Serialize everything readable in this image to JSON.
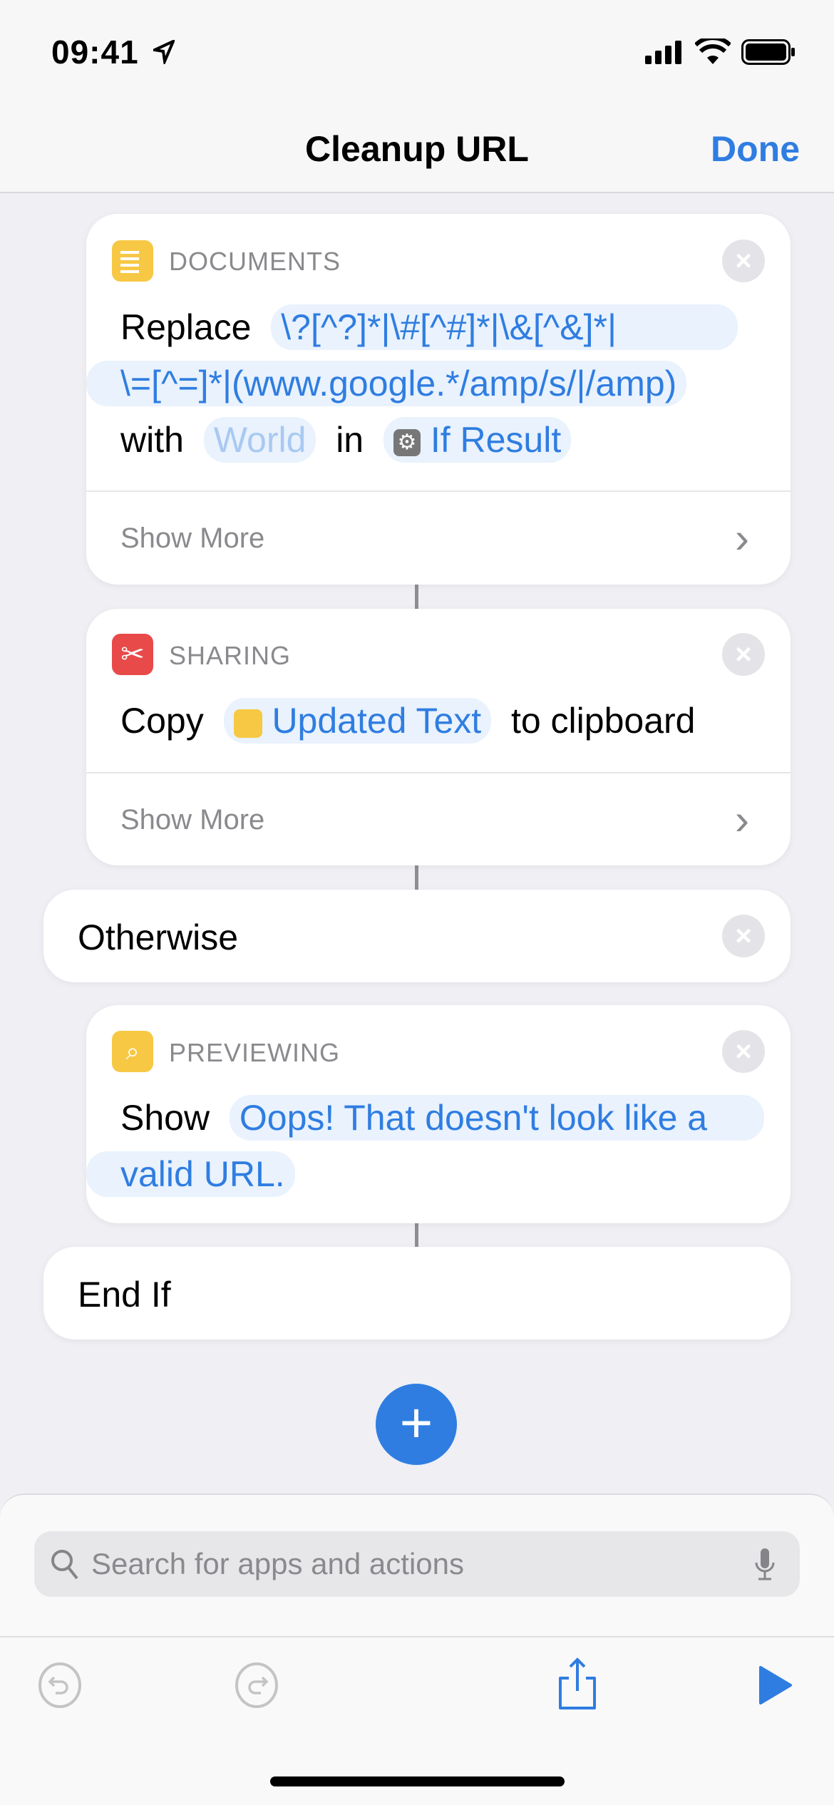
{
  "status": {
    "time": "09:41"
  },
  "nav": {
    "title": "Cleanup URL",
    "done": "Done"
  },
  "cards": [
    {
      "category": "DOCUMENTS",
      "icon": "document-icon",
      "color": "#f7c844",
      "verb": "Replace",
      "pattern_1": "\\?[^?]*|\\#[^#]*|\\&[^&]*|",
      "pattern_2": "\\=[^=]*|(www.google.*/amp/s/|/amp)",
      "with": "with",
      "with_placeholder": "World",
      "in": "in",
      "input": "If Result",
      "show_more": "Show More"
    },
    {
      "category": "SHARING",
      "icon": "scissors-icon",
      "color": "#e84a4a",
      "verb": "Copy",
      "variable": "Updated Text",
      "suffix": "to clipboard",
      "show_more": "Show More"
    },
    {
      "category": "PREVIEWING",
      "icon": "preview-icon",
      "color": "#f7c844",
      "verb": "Show",
      "text_1": "Oops! That doesn't look like a",
      "text_2": "valid URL."
    }
  ],
  "otherwise": "Otherwise",
  "end_if": "End If",
  "search": {
    "placeholder": "Search for apps and actions"
  },
  "accent": "#2f7de1"
}
